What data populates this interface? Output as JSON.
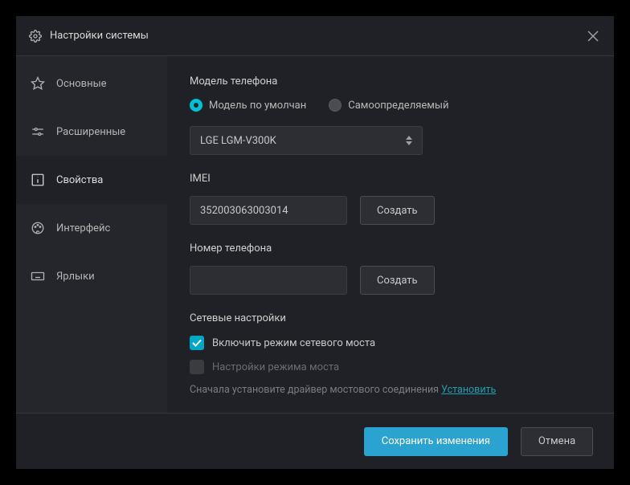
{
  "window": {
    "title": "Настройки системы"
  },
  "sidebar": {
    "items": [
      {
        "label": "Основные"
      },
      {
        "label": "Расширенные"
      },
      {
        "label": "Свойства"
      },
      {
        "label": "Интерфейс"
      },
      {
        "label": "Ярлыки"
      }
    ]
  },
  "content": {
    "phoneModel": {
      "title": "Модель телефона",
      "radioDefault": "Модель по умолчан",
      "radioSelf": "Самоопределяемый",
      "selectedValue": "LGE LGM-V300K"
    },
    "imei": {
      "title": "IMEI",
      "value": "352003063003014",
      "createBtn": "Создать"
    },
    "phoneNumber": {
      "title": "Номер телефона",
      "value": "",
      "createBtn": "Создать"
    },
    "network": {
      "title": "Сетевые настройки",
      "bridgeCheck": "Включить режим сетевого моста",
      "bridgeSettings": "Настройки режима моста",
      "hint": "Сначала установите драйвер мостового соединения",
      "installLink": "Установить"
    }
  },
  "footer": {
    "save": "Сохранить изменения",
    "cancel": "Отмена"
  }
}
